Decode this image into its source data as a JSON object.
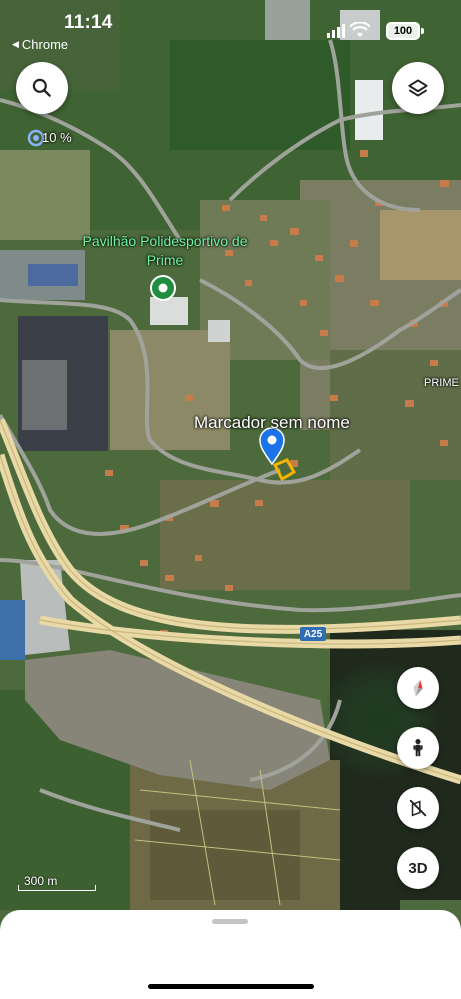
{
  "status_bar": {
    "time": "11:14",
    "back_app": "Chrome",
    "battery": "100"
  },
  "buttons": {
    "search_icon": "search-icon",
    "layers_icon": "layers-icon",
    "compass_icon": "compass-icon",
    "pegman_icon": "pegman-icon",
    "tilt_icon": "no-tilt-icon",
    "three_d_label": "3D"
  },
  "map": {
    "poi_name": "Pavilhão Polidesportivo de Prime",
    "marker_name": "Marcador sem nome",
    "place_label": "PRIME",
    "highway": "A25",
    "scale_label": "300 m",
    "location_accuracy": "10 %",
    "colors": {
      "poi_green": "#1e8e3e",
      "marker_blue": "#1a73e8",
      "road_yellow": "#f3dfa2",
      "highway_blue": "#2f6db5",
      "selection_yellow": "#f4b400"
    }
  }
}
